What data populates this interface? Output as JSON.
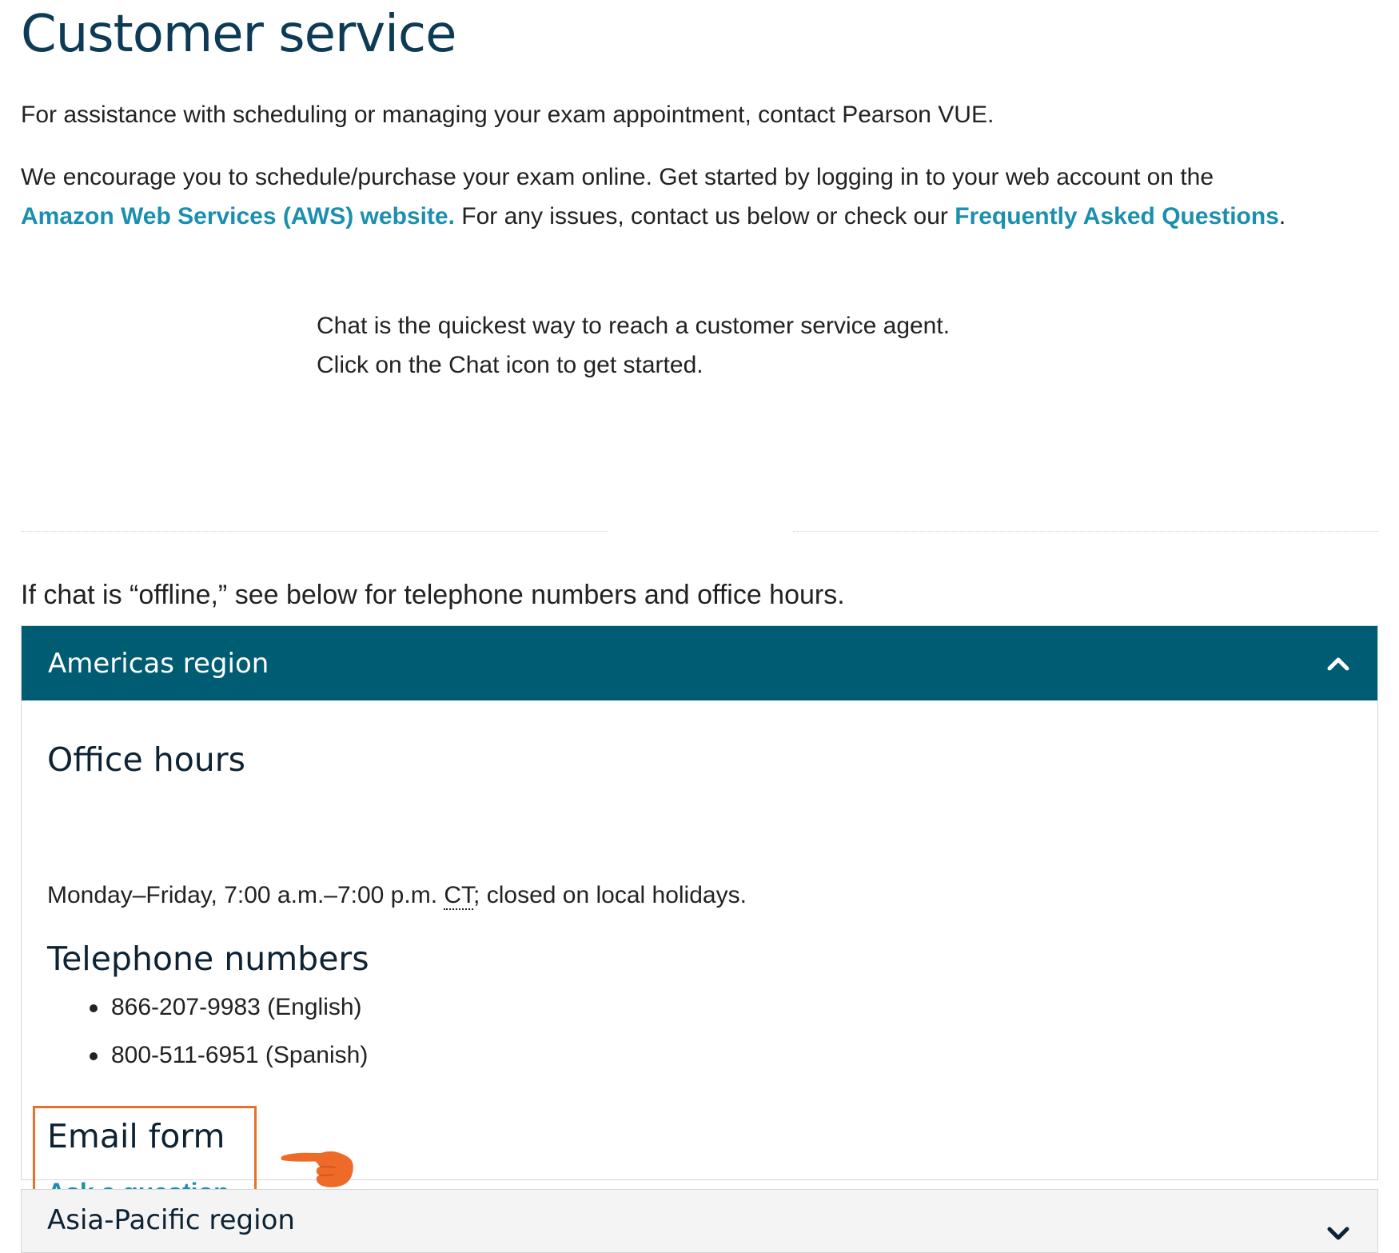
{
  "page": {
    "title": "Customer service",
    "intro_1": "For assistance with scheduling or managing your exam appointment, contact Pearson VUE.",
    "intro_2_line1": "We encourage you to schedule/purchase your exam online. Get started by logging in to your web account on the",
    "aws_link": "Amazon Web Services (AWS) website.",
    "intro_2_mid": " For any issues, contact us below or check our ",
    "faq_link": "Frequently Asked Questions",
    "intro_2_end": ".",
    "chat_line1": "Chat is the quickest way to reach a customer service agent.",
    "chat_line2": "Click on the Chat icon to get started.",
    "offline_note": "If chat is “offline,” see below for telephone numbers and office hours."
  },
  "americas": {
    "title": "Americas region",
    "expanded": true,
    "office_hours_heading": "Office hours",
    "hours_before": "Monday–Friday, 7:00 a.m.–7:00 p.m. ",
    "hours_abbr": "CT",
    "hours_after": "; closed on local holidays.",
    "telephone_heading": "Telephone numbers",
    "phones": [
      "866-207-9983 (English)",
      "800-511-6951 (Spanish)"
    ],
    "email_heading": "Email form",
    "ask_link": "Ask a question"
  },
  "asia_pacific": {
    "title": "Asia-Pacific region",
    "expanded": false
  },
  "colors": {
    "title_text": "#0d3b55",
    "link": "#1a8fb0",
    "accordion_header_bg": "#005c73",
    "highlight_box": "#e8702a",
    "pointer_hand": "#ee6a28"
  },
  "icons": {
    "accordion_open": "chevron-up-icon",
    "accordion_closed": "chevron-down-icon",
    "annotation": "pointing-hand-icon"
  }
}
